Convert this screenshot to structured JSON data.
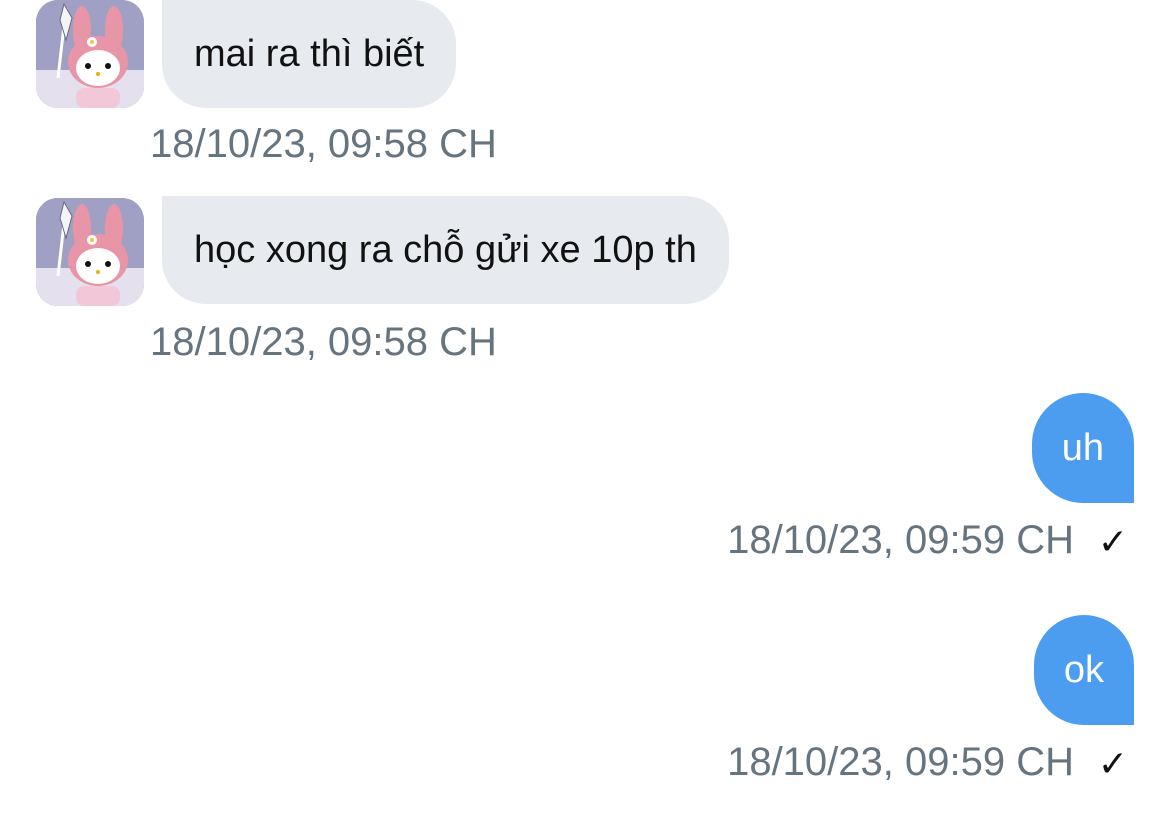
{
  "colors": {
    "incoming_bubble": "#e7ebef",
    "outgoing_bubble": "#4c9df0",
    "timestamp": "#66747f"
  },
  "messages": [
    {
      "direction": "incoming",
      "text": "mai ra thì biết",
      "time": "18/10/23, 09:58 CH",
      "avatar": "my-melody-avatar"
    },
    {
      "direction": "incoming",
      "text": "học xong ra chỗ gửi xe 10p th",
      "time": "18/10/23, 09:58 CH",
      "avatar": "my-melody-avatar"
    },
    {
      "direction": "outgoing",
      "text": "uh",
      "time": "18/10/23, 09:59 CH",
      "status_icon": "check-icon",
      "status_glyph": "✓"
    },
    {
      "direction": "outgoing",
      "text": "ok",
      "time": "18/10/23, 09:59 CH",
      "status_icon": "check-icon",
      "status_glyph": "✓"
    }
  ]
}
